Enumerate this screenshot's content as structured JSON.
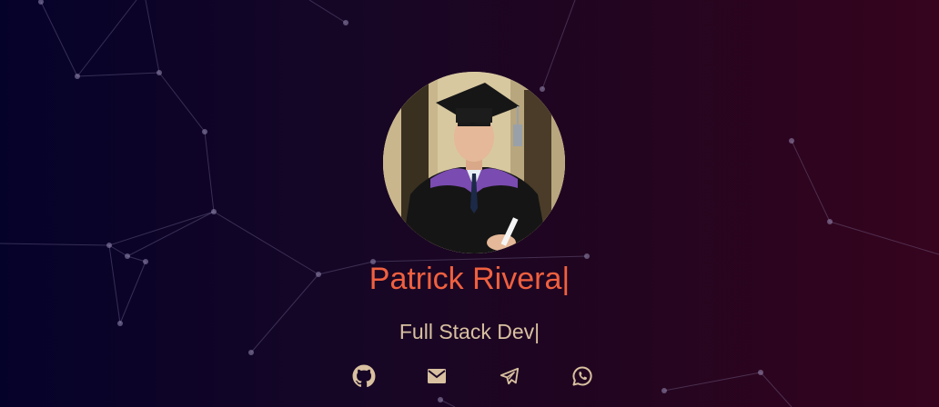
{
  "profile": {
    "name": "Patrick Rivera",
    "name_cursor": "|",
    "role": "Full Stack Dev",
    "role_cursor": "|",
    "avatar_alt": "graduation portrait"
  },
  "socials": [
    {
      "icon": "github-icon"
    },
    {
      "icon": "mail-icon"
    },
    {
      "icon": "telegram-icon"
    },
    {
      "icon": "whatsapp-icon"
    }
  ],
  "colors": {
    "name": "#f0603f",
    "role": "#d8c0a0",
    "icons": "#d8c0a0",
    "background_left": "#05022a",
    "background_right": "#36041e"
  }
}
